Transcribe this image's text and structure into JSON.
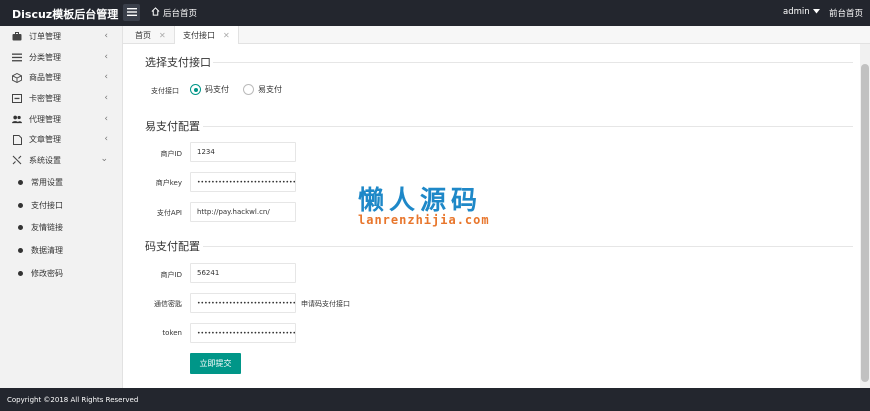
{
  "topbar": {
    "brand": "Discuz模板后台管理",
    "home_label": "后台首页",
    "user_label": "admin",
    "front_label": "前台首页"
  },
  "sidebar": {
    "items": [
      {
        "label": "订单管理",
        "icon": "briefcase-icon"
      },
      {
        "label": "分类管理",
        "icon": "list-icon"
      },
      {
        "label": "商品管理",
        "icon": "cube-icon"
      },
      {
        "label": "卡密管理",
        "icon": "card-icon"
      },
      {
        "label": "代理管理",
        "icon": "users-icon"
      },
      {
        "label": "文章管理",
        "icon": "document-icon"
      },
      {
        "label": "系统设置",
        "icon": "settings-icon"
      }
    ],
    "sub_items": [
      "常用设置",
      "支付接口",
      "友情链接",
      "数据清理",
      "修改密码"
    ]
  },
  "tabs": [
    {
      "label": "首页"
    },
    {
      "label": "支付接口"
    }
  ],
  "select_section": {
    "title": "选择支付接口",
    "field_label": "支付接口",
    "options": [
      "码支付",
      "易支付"
    ],
    "selected": "码支付"
  },
  "yizhifu_section": {
    "title": "易支付配置",
    "fields": [
      {
        "label": "商户ID",
        "value": "1234"
      },
      {
        "label": "商户key",
        "value": "••••••••••••••••••••••••••••••••"
      },
      {
        "label": "支付API",
        "value": "http://pay.hackwl.cn/"
      }
    ]
  },
  "mazhifu_section": {
    "title": "码支付配置",
    "fields": [
      {
        "label": "商户ID",
        "value": "56241"
      },
      {
        "label": "通信密匙",
        "value": "••••••••••••••••••••••••••••••••",
        "hint": "申请码支付接口"
      },
      {
        "label": "token",
        "value": "••••••••••••••••••••••••••••••••"
      }
    ]
  },
  "submit_label": "立即提交",
  "watermark": {
    "main": "懒人源码",
    "sub": "lanrenzhijia.com"
  },
  "footer": {
    "copyright": "Copyright ©2018 All Rights Reserved"
  },
  "colors": {
    "topbar_bg": "#23262e",
    "accent": "#009688",
    "sidebar_bg": "#f2f2f2"
  }
}
